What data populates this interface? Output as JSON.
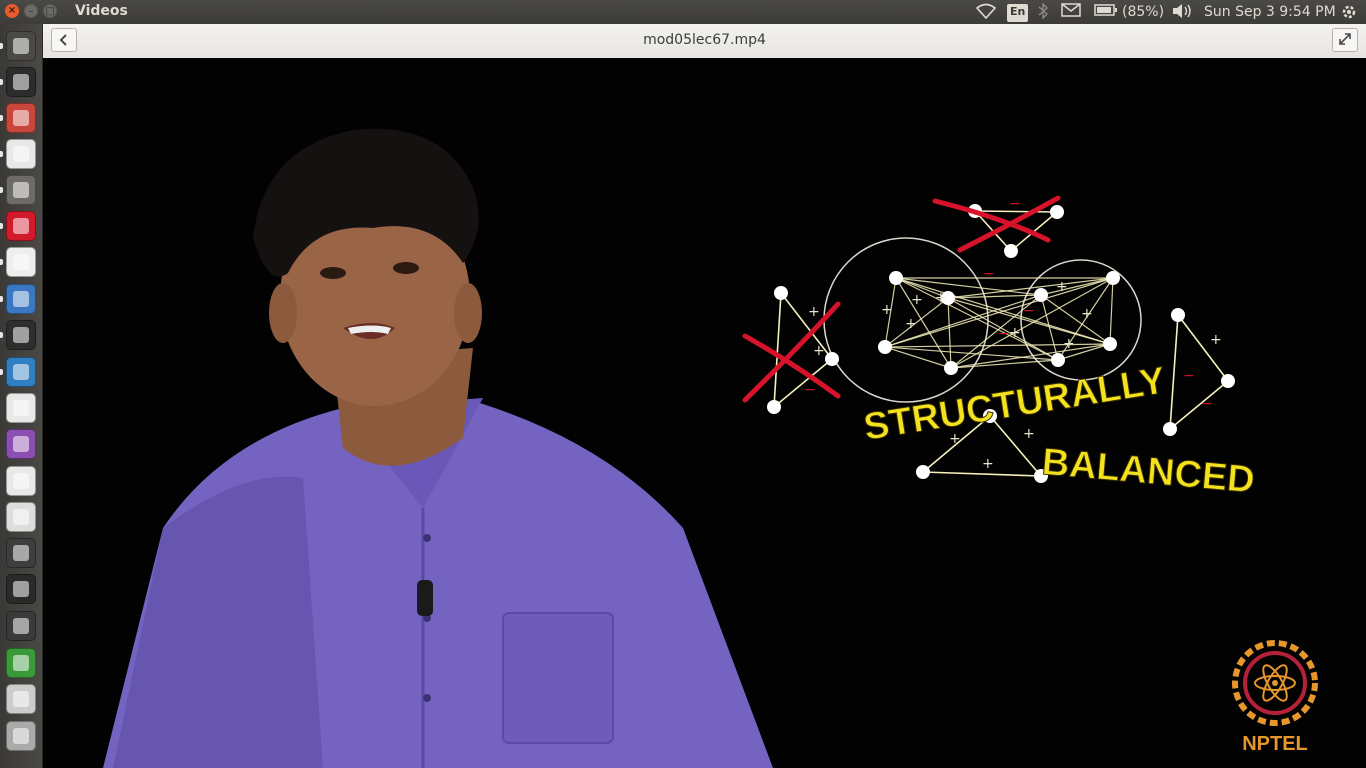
{
  "window": {
    "app_title": "Videos",
    "close_icon": "×",
    "min_icon": "–",
    "max_icon": "□"
  },
  "tray": {
    "wifi_icon": "wifi-icon",
    "keyboard_layout": "En",
    "battery_percent": "(85%)",
    "datetime": "Sun Sep  3  9:54 PM"
  },
  "header": {
    "file_name": "mod05lec67.mp4"
  },
  "launcher": {
    "items": [
      {
        "name": "dash-home",
        "color": "#4a4946"
      },
      {
        "name": "terminal",
        "color": "#2c2c2c"
      },
      {
        "name": "files-archive",
        "color": "#c9463d"
      },
      {
        "name": "chrome",
        "color": "#e8e8e8"
      },
      {
        "name": "settings",
        "color": "#6d6b67"
      },
      {
        "name": "opera",
        "color": "#d11a2a"
      },
      {
        "name": "document-viewer",
        "color": "#eeeeee"
      },
      {
        "name": "r-language",
        "color": "#3a78c2"
      },
      {
        "name": "video-editor",
        "color": "#2e2e2e"
      },
      {
        "name": "text-document",
        "color": "#2f7fc1"
      },
      {
        "name": "gmail",
        "color": "#e8e8e8"
      },
      {
        "name": "media-player",
        "color": "#8a4fb0"
      },
      {
        "name": "presentation",
        "color": "#e8e8e8"
      },
      {
        "name": "text-editor",
        "color": "#dddddd"
      },
      {
        "name": "sublime-text",
        "color": "#3e3e3e"
      },
      {
        "name": "ipython",
        "color": "#2a2a2a"
      },
      {
        "name": "geogebra",
        "color": "#3a3a3a"
      },
      {
        "name": "spreadsheet",
        "color": "#3a9a3a"
      },
      {
        "name": "drive",
        "color": "#cccccc"
      },
      {
        "name": "trash",
        "color": "#aaaaaa"
      }
    ]
  },
  "video": {
    "overlay_line1": "STRUCTURALLY",
    "overlay_line2": "BALANCED",
    "watermark_text": "NPTEL",
    "plus": "+",
    "minus": "−"
  },
  "colors": {
    "accent_yellow": "#f5e21e",
    "cross_red": "#d6132a",
    "edge_cream": "#f6f0bb"
  }
}
